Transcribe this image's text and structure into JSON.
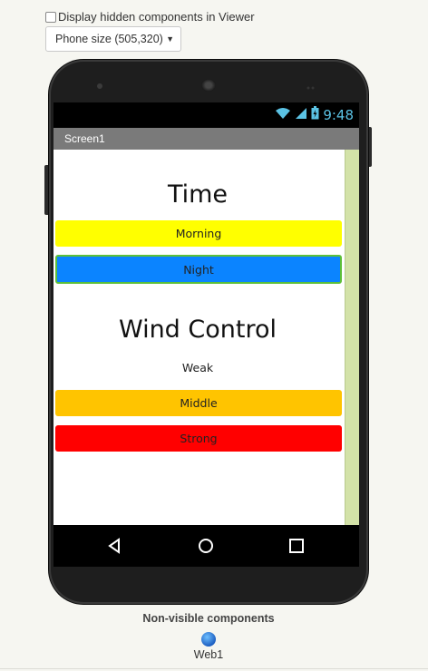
{
  "viewer": {
    "hidden_label": "Display hidden components in Viewer",
    "hidden_checked": false,
    "size_selected": "Phone size (505,320)"
  },
  "status": {
    "time": "9:48"
  },
  "screen": {
    "title": "Screen1",
    "time_heading": "Time",
    "morning": "Morning",
    "night": "Night",
    "wind_heading": "Wind Control",
    "weak": "Weak",
    "middle": "Middle",
    "strong": "Strong"
  },
  "nonvisible": {
    "heading": "Non-visible components",
    "items": [
      {
        "label": "Web1",
        "icon": "globe-icon"
      }
    ]
  },
  "colors": {
    "morning": "#ffff00",
    "night": "#0b84ff",
    "middle": "#ffc400",
    "strong": "#ff0000",
    "scrollbar": "#d3e2a8"
  }
}
